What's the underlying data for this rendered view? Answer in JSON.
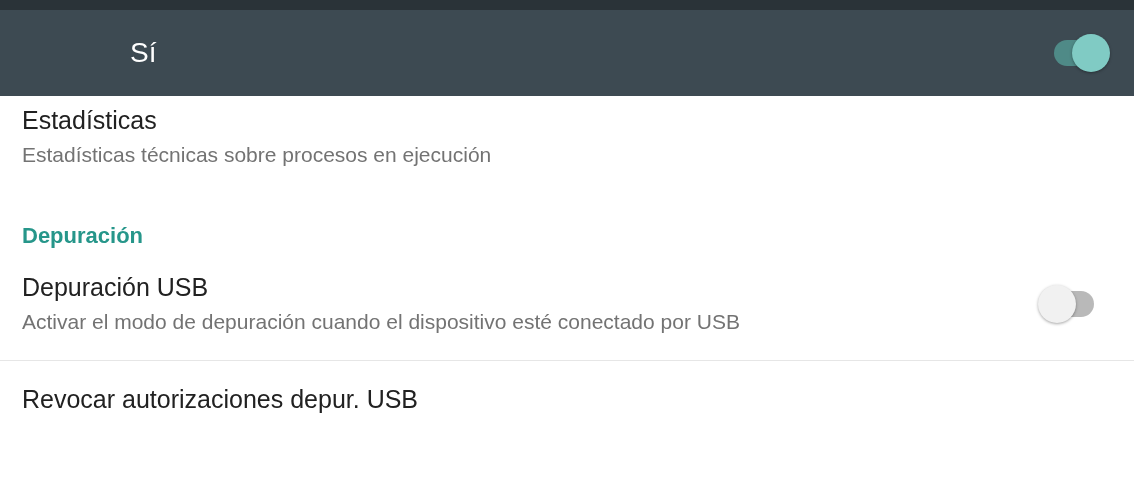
{
  "header": {
    "title": "Sí",
    "switch_on": true
  },
  "items": [
    {
      "kind": "preference",
      "title": "Estadísticas",
      "summary": "Estadísticas técnicas sobre procesos en ejecución"
    },
    {
      "kind": "category",
      "title": "Depuración"
    },
    {
      "kind": "switch",
      "title": "Depuración USB",
      "summary": "Activar el modo de depuración cuando el dispositivo esté conectado por USB",
      "on": false
    },
    {
      "kind": "preference",
      "title": "Revocar autorizaciones depur. USB"
    }
  ]
}
